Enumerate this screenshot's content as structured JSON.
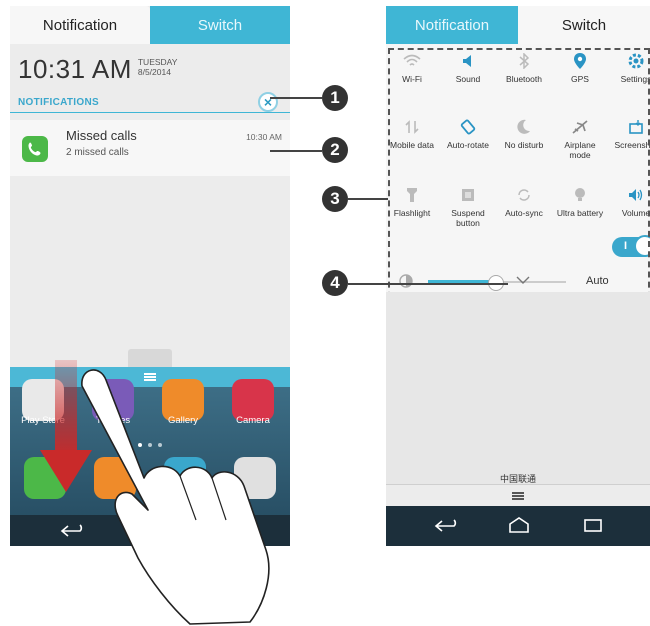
{
  "left_screen": {
    "tabs": [
      "Notification",
      "Switch"
    ],
    "time": "10:31 AM",
    "day": "TUESDAY",
    "date": "8/5/2014",
    "section_header": "NOTIFICATIONS",
    "clear_glyph": "×",
    "notification": {
      "icon": "phone-icon",
      "title": "Missed calls",
      "subtitle": "2 missed calls",
      "time": "10:30 AM"
    },
    "home_apps": [
      "Play Store",
      "Themes",
      "Gallery",
      "Camera"
    ]
  },
  "right_screen": {
    "tabs": [
      "Notification",
      "Switch"
    ],
    "toggles": [
      {
        "label": "Wi-Fi",
        "icon": "wifi-icon"
      },
      {
        "label": "Sound",
        "icon": "sound-icon"
      },
      {
        "label": "Bluetooth",
        "icon": "bluetooth-icon"
      },
      {
        "label": "GPS",
        "icon": "gps-icon"
      },
      {
        "label": "Settings",
        "icon": "gear-icon"
      },
      {
        "label": "Mobile data",
        "icon": "mobile-data-icon"
      },
      {
        "label": "Auto-rotate",
        "icon": "rotate-icon"
      },
      {
        "label": "No disturb",
        "icon": "moon-icon"
      },
      {
        "label": "Airplane mode",
        "icon": "airplane-icon"
      },
      {
        "label": "Screenshot",
        "icon": "screenshot-icon"
      },
      {
        "label": "Flashlight",
        "icon": "flashlight-icon"
      },
      {
        "label": "Suspend button",
        "icon": "suspend-icon"
      },
      {
        "label": "Auto-sync",
        "icon": "sync-icon"
      },
      {
        "label": "Ultra battery",
        "icon": "bulb-icon"
      },
      {
        "label": "Volume",
        "icon": "volume-icon"
      }
    ],
    "brightness_auto_label": "Auto",
    "toggle_state": "I",
    "carrier": "中国联通"
  },
  "callouts": [
    "1",
    "2",
    "3",
    "4"
  ],
  "colors": {
    "accent": "#3fb6d5",
    "green": "#4cb848",
    "arrow": "#c92a2a",
    "nav": "#1c2f3b"
  }
}
